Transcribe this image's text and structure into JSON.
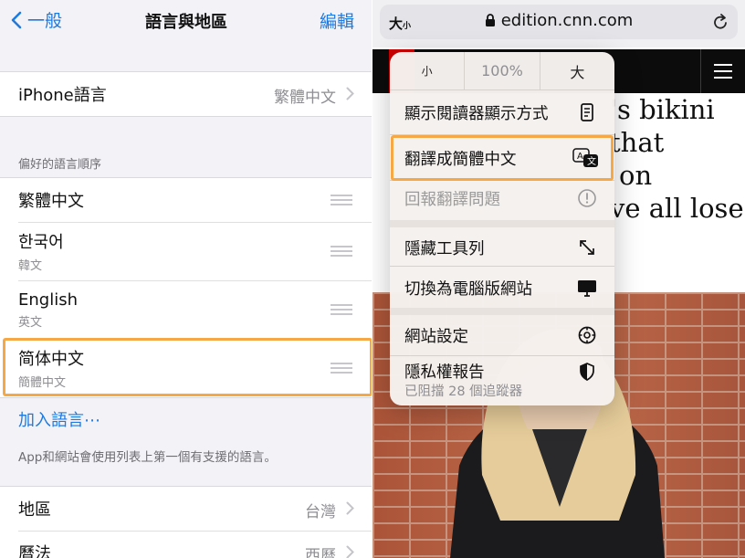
{
  "left": {
    "nav": {
      "back_label": "一般",
      "title": "語言與地區",
      "edit_label": "編輯"
    },
    "iphone_language": {
      "label": "iPhone語言",
      "value": "繁體中文"
    },
    "preferred_header": "偏好的語言順序",
    "languages": [
      {
        "name": "繁體中文",
        "sub": ""
      },
      {
        "name": "한국어",
        "sub": "韓文"
      },
      {
        "name": "English",
        "sub": "英文"
      },
      {
        "name": "简体中文",
        "sub": "簡體中文"
      }
    ],
    "add_language": "加入語言⋯",
    "footnote": "App和網站會使用列表上第一個有支援的語言。",
    "region": {
      "label": "地區",
      "value": "台灣"
    },
    "calendar": {
      "label": "曆法",
      "value": "西曆"
    },
    "highlight_color": "#f6a847"
  },
  "right": {
    "url_bar": {
      "text_size_label": "大",
      "text_size_small": "小",
      "url": "edition.cnn.com"
    },
    "article_lines": [
      "'s bikini",
      "that",
      "on",
      "ve all lose"
    ],
    "menu": {
      "zoom": {
        "smaller": "小",
        "percent": "100%",
        "larger": "大"
      },
      "items": {
        "reader": "顯示閱讀器顯示方式",
        "translate": "翻譯成簡體中文",
        "report": "回報翻譯問題",
        "hide_toolbar": "隱藏工具列",
        "desktop": "切換為電腦版網站",
        "website_settings": "網站設定",
        "privacy": "隱私權報告",
        "privacy_sub": "已阻擋 28 個追蹤器"
      }
    },
    "colors": {
      "link": "#1f7ae0",
      "cnn_red": "#cc0000"
    }
  }
}
